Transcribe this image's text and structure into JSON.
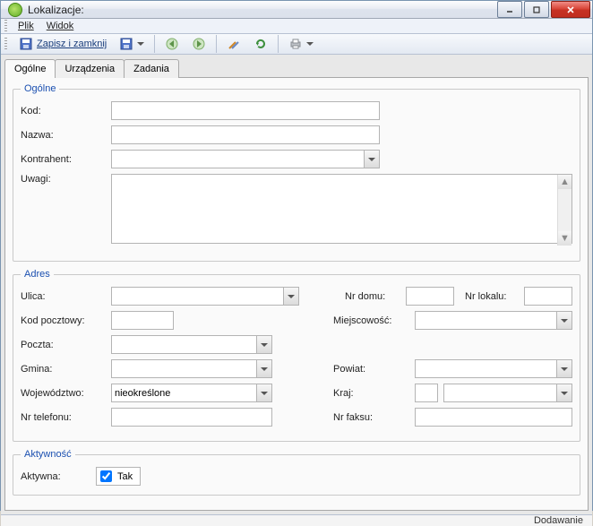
{
  "window": {
    "title": "Lokalizacje:"
  },
  "menu": {
    "plik": "Plik",
    "widok": "Widok"
  },
  "toolbar": {
    "save_close": "Zapisz i zamknij"
  },
  "tabs": {
    "ogolne": "Ogólne",
    "urzadzenia": "Urządzenia",
    "zadania": "Zadania"
  },
  "group": {
    "ogolne": "Ogólne",
    "adres": "Adres",
    "aktywnosc": "Aktywność"
  },
  "labels": {
    "kod": "Kod:",
    "nazwa": "Nazwa:",
    "kontrahent": "Kontrahent:",
    "uwagi": "Uwagi:",
    "ulica": "Ulica:",
    "nr_domu": "Nr domu:",
    "nr_lokalu": "Nr lokalu:",
    "kod_pocztowy": "Kod pocztowy:",
    "miejscowosc": "Miejscowość:",
    "poczta": "Poczta:",
    "gmina": "Gmina:",
    "powiat": "Powiat:",
    "wojewodztwo": "Województwo:",
    "kraj": "Kraj:",
    "nr_telefonu": "Nr telefonu:",
    "nr_faksu": "Nr faksu:",
    "aktywna": "Aktywna:"
  },
  "values": {
    "kod": "",
    "nazwa": "",
    "kontrahent": "",
    "uwagi": "",
    "ulica": "",
    "nr_domu": "",
    "nr_lokalu": "",
    "kod_pocztowy": "",
    "miejscowosc": "",
    "poczta": "",
    "gmina": "",
    "powiat": "",
    "wojewodztwo": "nieokreślone",
    "kraj_code": "",
    "kraj": "",
    "nr_telefonu": "",
    "nr_faksu": "",
    "aktywna_checked": true,
    "aktywna_text": "Tak"
  },
  "status": {
    "text": "Dodawanie"
  }
}
